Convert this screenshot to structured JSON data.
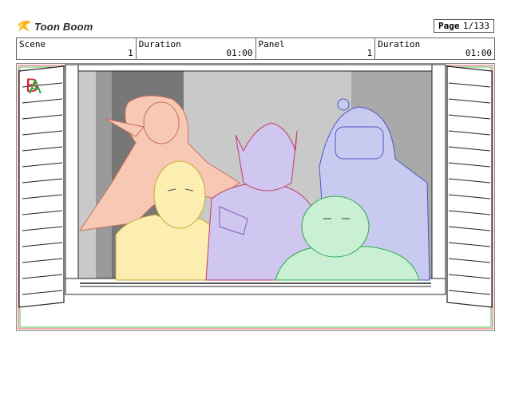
{
  "logo": {
    "text": "Toon Boom"
  },
  "page": {
    "label": "Page",
    "value": "1/133"
  },
  "info": {
    "scene_label": "Scene",
    "scene_value": "1",
    "duration_label": "Duration",
    "duration_value": "01:00",
    "panel_label": "Panel",
    "panel_value": "1",
    "panel_duration_label": "Duration",
    "panel_duration_value": "01:00"
  },
  "panel_image": {
    "corner_mark": "B",
    "corner_mark_overlay": "A",
    "description_icons": [
      "window-frame",
      "shutter-left",
      "shutter-right"
    ],
    "colors": {
      "elf": "#f7c9b4",
      "monk": "#fbeeb0",
      "demon": "#cfc7ef",
      "knight": "#c8cbef",
      "ogre": "#c9efd4",
      "corner_red": "#d8222e",
      "corner_green": "#2fa84a"
    }
  }
}
